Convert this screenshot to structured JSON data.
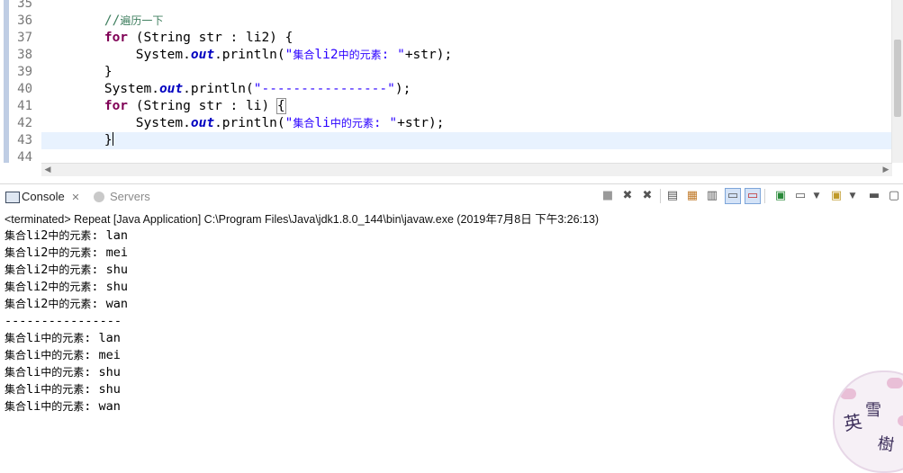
{
  "editor": {
    "line_numbers": [
      "35",
      "36",
      "37",
      "38",
      "39",
      "40",
      "41",
      "42",
      "43",
      "44"
    ],
    "lines": [
      {
        "type": "blank"
      },
      {
        "type": "comment",
        "indent": "        ",
        "text": "//遍历一下"
      },
      {
        "type": "for",
        "indent": "        ",
        "kw": "for",
        "rest": " (String str : li2) {"
      },
      {
        "type": "println",
        "indent": "            ",
        "prefix": "System.",
        "field": "out",
        "call": ".println(",
        "string": "\"集合li2中的元素: \"",
        "tail": "+str);"
      },
      {
        "type": "plain",
        "indent": "        ",
        "text": "}"
      },
      {
        "type": "println",
        "indent": "        ",
        "prefix": "System.",
        "field": "out",
        "call": ".println(",
        "string": "\"----------------\"",
        "tail": ");"
      },
      {
        "type": "for_brace",
        "indent": "        ",
        "kw": "for",
        "rest": " (String str : li) ",
        "brace": "{"
      },
      {
        "type": "println",
        "indent": "            ",
        "prefix": "System.",
        "field": "out",
        "call": ".println(",
        "string": "\"集合li中的元素: \"",
        "tail": "+str);"
      },
      {
        "type": "current",
        "indent": "        ",
        "text": "}"
      },
      {
        "type": "blank"
      }
    ]
  },
  "console": {
    "tabs": [
      {
        "label": "Console",
        "close": "✕",
        "icon": "console-icon",
        "active": true
      },
      {
        "label": "Servers",
        "icon": "servers-icon",
        "active": false
      }
    ],
    "toolbar_icons": [
      "terminate-icon",
      "remove-launch-icon",
      "remove-all-terminated-icon",
      "clear-console-icon",
      "scroll-lock-icon",
      "word-wrap-icon",
      "show-on-stdout-icon",
      "show-on-stderr-icon",
      "pin-console-icon",
      "display-console-icon",
      "dropdown-icon",
      "open-console-icon",
      "dropdown-icon",
      "minimize-icon",
      "maximize-icon"
    ],
    "terminated_line": "<terminated> Repeat [Java Application] C:\\Program Files\\Java\\jdk1.8.0_144\\bin\\javaw.exe (2019年7月8日 下午3:26:13)",
    "output": [
      "集合li2中的元素: lan",
      "集合li2中的元素: mei",
      "集合li2中的元素: shu",
      "集合li2中的元素: shu",
      "集合li2中的元素: wan",
      "----------------",
      "集合li中的元素: lan",
      "集合li中的元素: mei",
      "集合li中的元素: shu",
      "集合li中的元素: shu",
      "集合li中的元素: wan"
    ]
  },
  "watermark": {
    "chars": [
      "英",
      "雪",
      "樹"
    ],
    "colors": {
      "petal": "#e9bfd7",
      "ink": "#3d2f5b"
    }
  },
  "colors": {
    "keyword": "#7f0055",
    "field": "#0000c0",
    "string": "#2a00ff",
    "comment": "#3f7f5f",
    "current_line": "#e8f2fe",
    "gutter_bar": "#bfcde4"
  }
}
